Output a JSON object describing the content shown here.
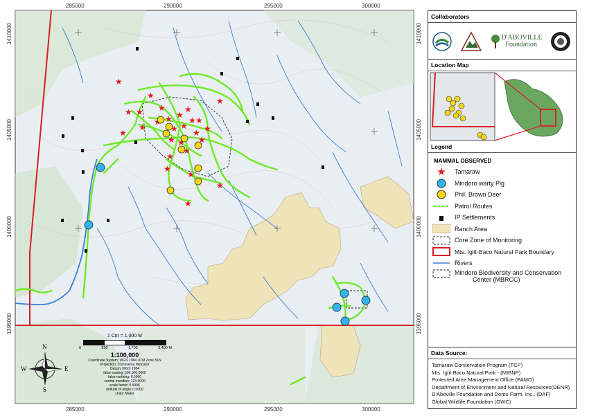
{
  "map": {
    "x_ticks": [
      "285000",
      "290000",
      "295000",
      "300000"
    ],
    "y_ticks_left": [
      "1410000",
      "1405000",
      "1400000",
      "1395000"
    ],
    "y_ticks_right": [
      "1410000",
      "1405000",
      "1400000",
      "1395000"
    ],
    "colors": {
      "tamaraw": "#e21b1b",
      "patrol": "#6fea2a",
      "boundary": "#d61f26",
      "river": "#3d7fd6",
      "ranch": "#efe3b8",
      "deer": "#f4d619",
      "pig": "#36b3e6"
    }
  },
  "panel": {
    "collaborators_title": "Collaborators",
    "logo_foundation_name": "D'ABOVILLE",
    "logo_foundation_sub": "Foundation",
    "location_title": "Location Map",
    "legend_title": "Legend",
    "legend_heading": "MAMMAL OBSERVED",
    "legend_items": [
      {
        "label": "Tamaraw",
        "icon": "star-icon"
      },
      {
        "label": "Mindoro warty Pig",
        "icon": "pig-icon"
      },
      {
        "label": "Phil. Brown Deer",
        "icon": "deer-icon"
      },
      {
        "label": "Patrol Routes",
        "icon": "dash-line-icon"
      },
      {
        "label": "IP Settlements",
        "icon": "house-icon"
      },
      {
        "label": "Ranch Area",
        "icon": "ranch-swatch"
      },
      {
        "label": "Core Zone of Monitoring",
        "icon": "dashed-box-icon"
      },
      {
        "label": "Mts. Iglit-Baco Natural Park Boundary",
        "icon": "red-box-icon"
      },
      {
        "label": "Rivers",
        "icon": "river-line-icon"
      },
      {
        "label": "Mindoro Biodiversity and Conservation",
        "icon": "dashed-box-icon"
      }
    ],
    "legend_last_line2": "Center  (MBRCC)",
    "source_title": "Data Source:",
    "sources": [
      "Tamaraw Conservation Program (TCP)",
      "Mts. Iglit-Baco Natural Park - (MIBNP)",
      "Protected Area Management Office (PAMO)",
      "Department of Environment and Natural Resources(DENR)",
      "D'Aboville Foundation and Demo Farm, Inc., (DAF)",
      "Global Wildlife Foundation (GWC)"
    ]
  },
  "scale": {
    "ratio_text": "1 Cm = 1,000 M",
    "bar_labels": [
      "0",
      "850",
      "1,700",
      "3,400 M"
    ],
    "scale": "1:100,000",
    "meta": [
      "Coordinate System: WGS 1984 UTM Zone 51N",
      "Projection: Transverse Mercator",
      "Datum: WGS 1984",
      "false easting: 500,000.0000",
      "false northing: 0.0000",
      "central meridian: 123.0000",
      "scale factor: 0.9996",
      "latitude of origin: 0.0000",
      "Units: Meter"
    ],
    "compass": {
      "n": "N",
      "s": "S",
      "e": "E",
      "w": "W"
    }
  }
}
